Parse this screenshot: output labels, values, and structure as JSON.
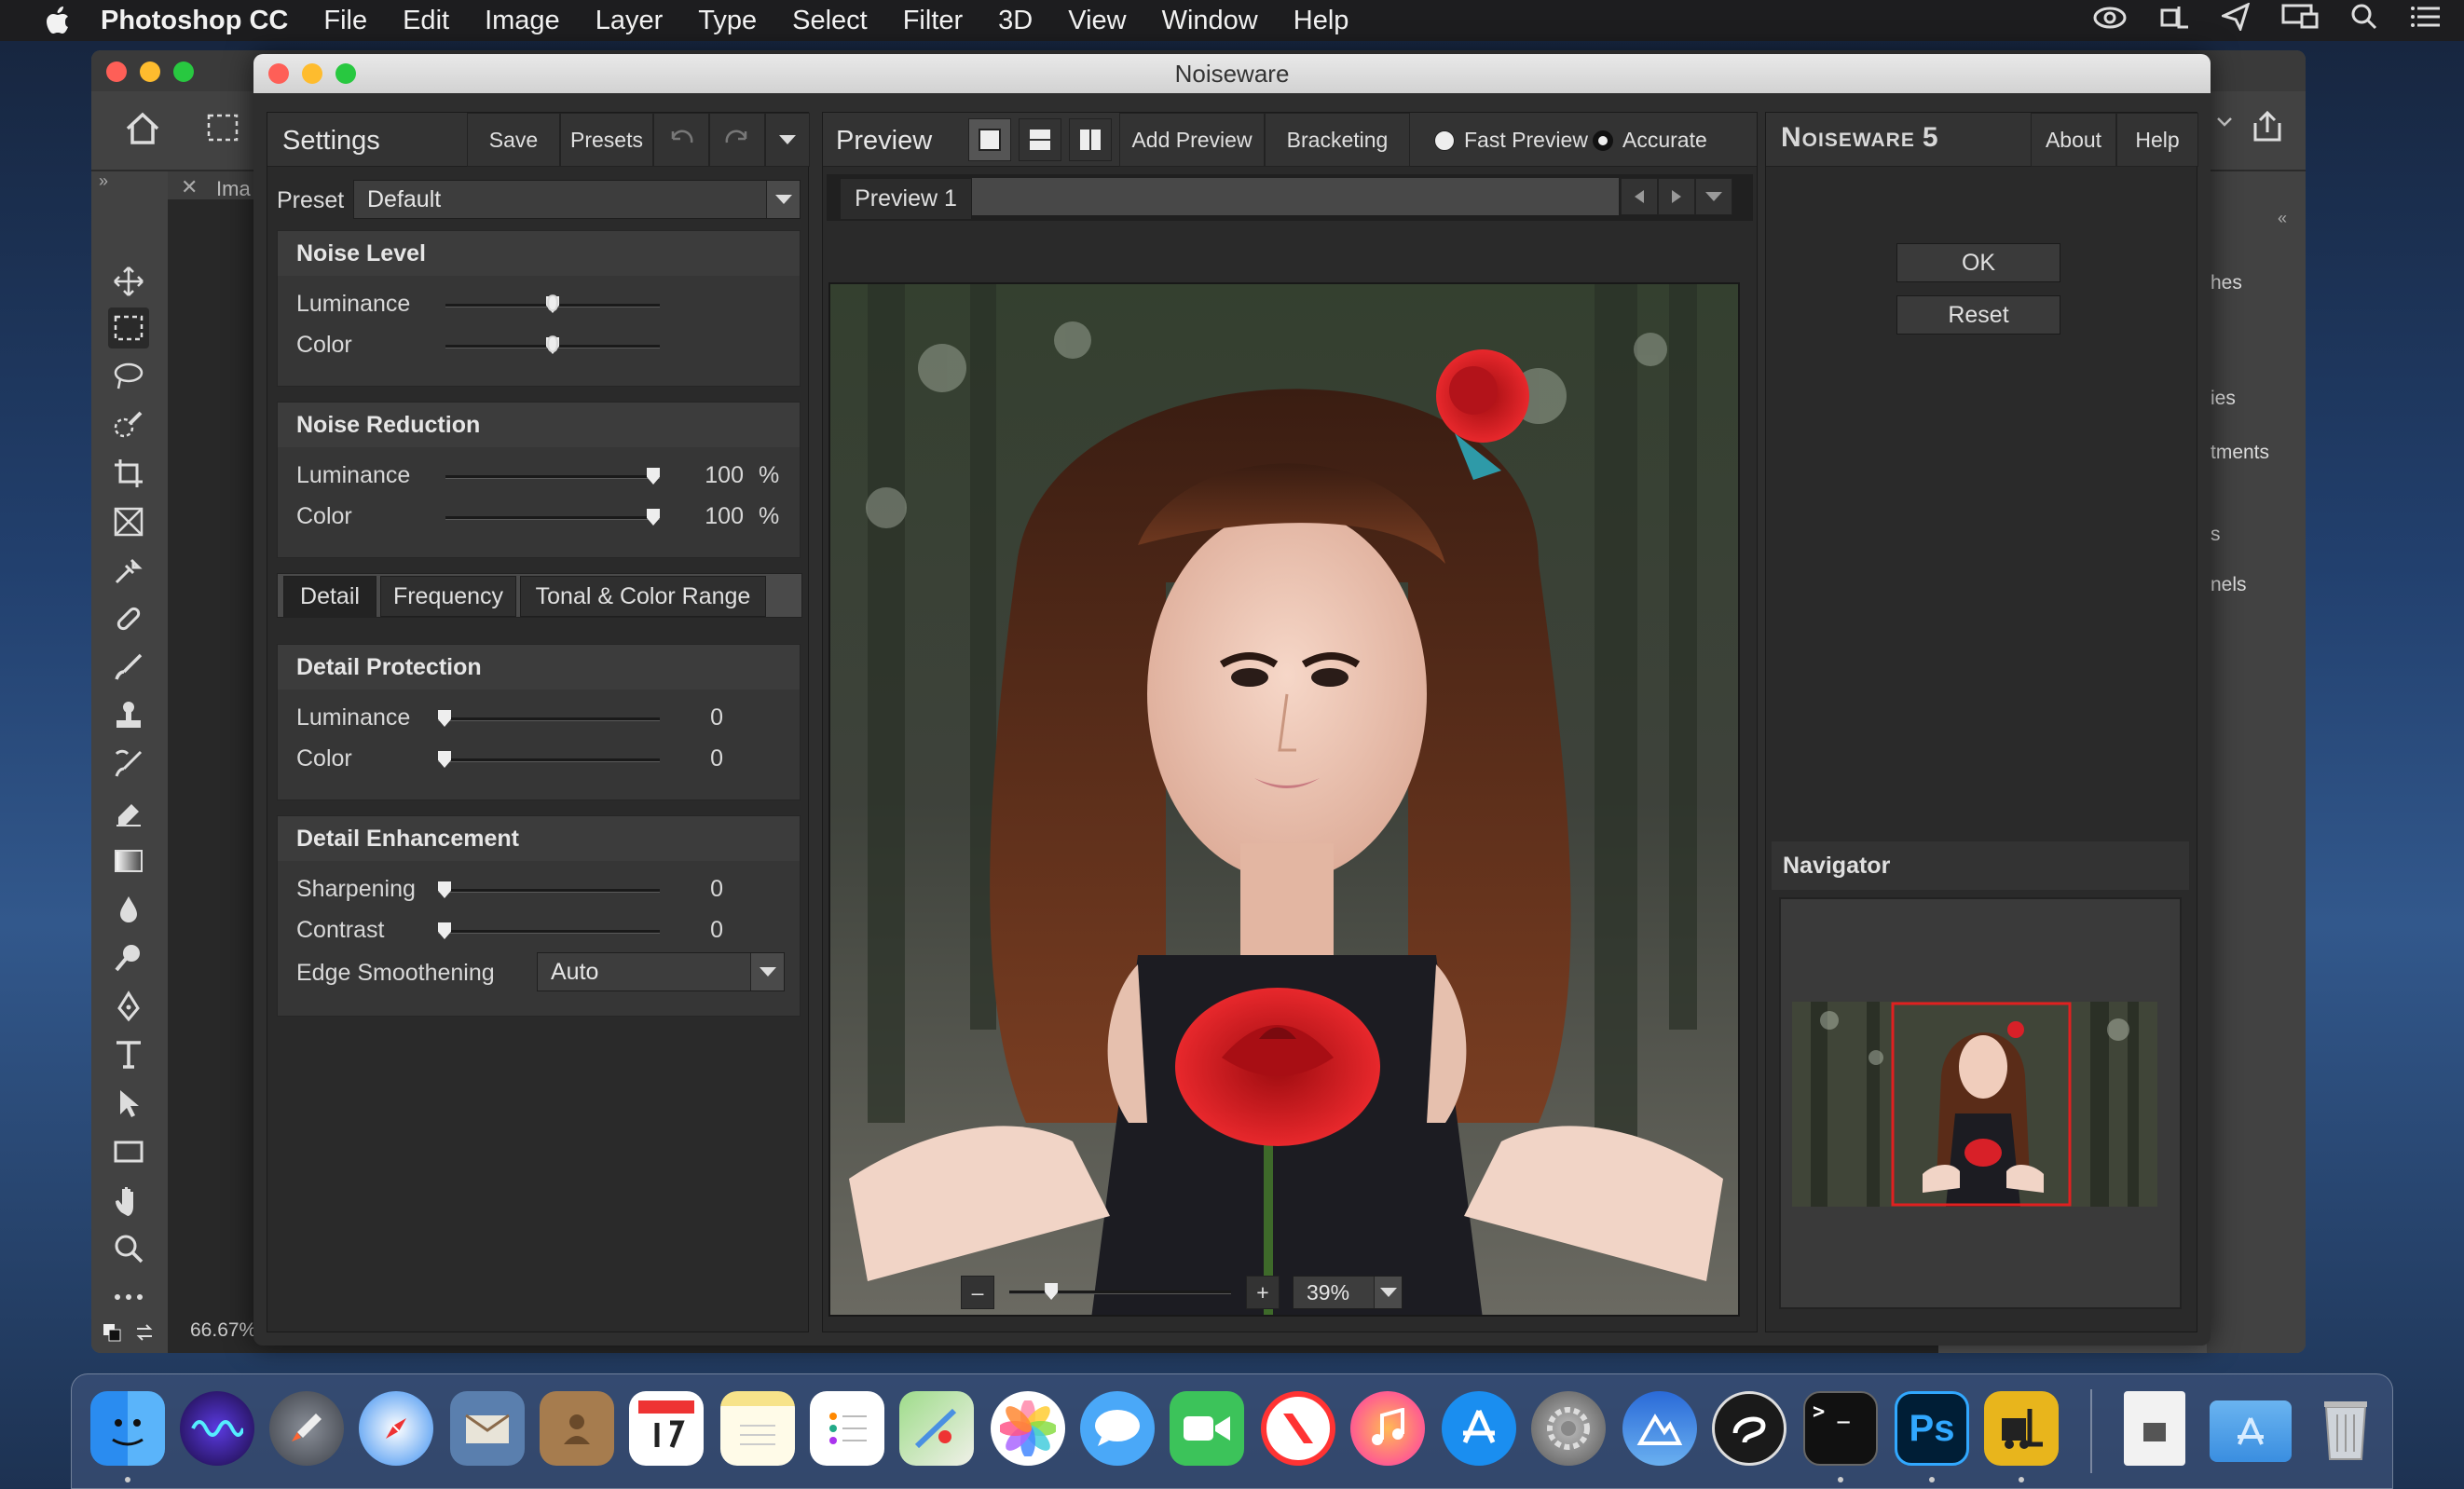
{
  "menubar": {
    "app": "Photoshop CC",
    "items": [
      "File",
      "Edit",
      "Image",
      "Layer",
      "Type",
      "Select",
      "Filter",
      "3D",
      "View",
      "Window",
      "Help"
    ]
  },
  "ps": {
    "doc_tab": "Ima",
    "zoom_status": "66.67%",
    "right_panel": [
      "hes",
      "ies",
      "tments",
      "s",
      "nels"
    ]
  },
  "dialog": {
    "title": "Noiseware",
    "settings": {
      "title": "Settings",
      "save": "Save",
      "presets": "Presets",
      "preset_label": "Preset",
      "preset_value": "Default",
      "noise_level": {
        "title": "Noise Level",
        "rows": [
          {
            "label": "Luminance",
            "value": "0",
            "pos": 0.5
          },
          {
            "label": "Color",
            "value": "0",
            "pos": 0.5
          }
        ]
      },
      "noise_reduction": {
        "title": "Noise Reduction",
        "rows": [
          {
            "label": "Luminance",
            "value": "100",
            "unit": "%",
            "pos": 1.0
          },
          {
            "label": "Color",
            "value": "100",
            "unit": "%",
            "pos": 1.0
          }
        ]
      },
      "tabs": [
        "Detail",
        "Frequency",
        "Tonal & Color Range"
      ],
      "detail_protection": {
        "title": "Detail Protection",
        "rows": [
          {
            "label": "Luminance",
            "value": "0",
            "pos": 0
          },
          {
            "label": "Color",
            "value": "0",
            "pos": 0
          }
        ]
      },
      "detail_enhancement": {
        "title": "Detail Enhancement",
        "rows": [
          {
            "label": "Sharpening",
            "value": "0",
            "pos": 0
          },
          {
            "label": "Contrast",
            "value": "0",
            "pos": 0
          }
        ],
        "edge_label": "Edge Smoothening",
        "edge_value": "Auto"
      }
    },
    "preview": {
      "title": "Preview",
      "add_preview": "Add Preview",
      "bracketing": "Bracketing",
      "fast_preview": "Fast Preview",
      "accurate": "Accurate",
      "selected_mode": "Accurate",
      "tab": "Preview 1",
      "zoom": "39%",
      "zoom_minus": "–",
      "zoom_plus": "+",
      "zoom_level": 0.17
    },
    "right": {
      "brand": "Noiseware",
      "version": "5",
      "about": "About",
      "help": "Help",
      "ok": "OK",
      "reset": "Reset",
      "navigator": "Navigator"
    }
  },
  "dock": {
    "terminal_glyph": "> _",
    "ps_label": "Ps"
  },
  "colors": {
    "accent_red": "#e02020",
    "ps_blue": "#31a8ff"
  }
}
